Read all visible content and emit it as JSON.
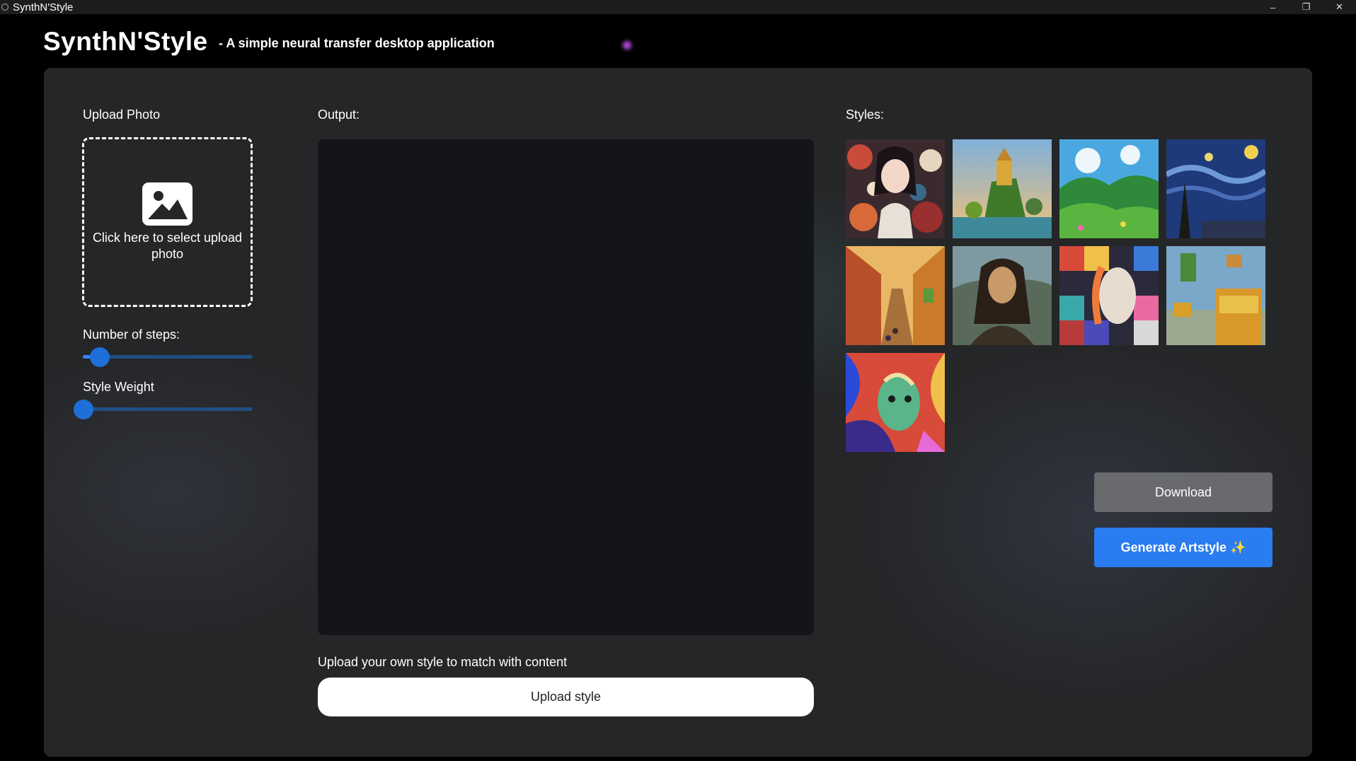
{
  "window": {
    "title": "SynthN'Style",
    "minimize": "–",
    "restore": "❐",
    "close": "✕"
  },
  "header": {
    "brand": "SynthN'Style",
    "tagline": "- A simple neural transfer desktop application"
  },
  "left": {
    "upload_label": "Upload Photo",
    "upload_prompt": "Click here to select upload photo",
    "steps_label": "Number of steps:",
    "steps_value": 0.1,
    "weight_label": "Style Weight",
    "weight_value": 0.0
  },
  "center": {
    "output_label": "Output:",
    "upload_own_label": "Upload your own style to match with content",
    "upload_style_button": "Upload style"
  },
  "right": {
    "styles_label": "Styles:",
    "styles": [
      {
        "icon": "anime-girl-floral-style"
      },
      {
        "icon": "fantasy-castle-landscape-style"
      },
      {
        "icon": "green-hills-landscape-style"
      },
      {
        "icon": "starry-night-style"
      },
      {
        "icon": "street-painting-style"
      },
      {
        "icon": "mona-lisa-style"
      },
      {
        "icon": "cubist-portrait-style"
      },
      {
        "icon": "van-gogh-bedroom-style"
      },
      {
        "icon": "abstract-face-style"
      }
    ],
    "download_button": "Download",
    "generate_button": "Generate Artstyle ✨"
  },
  "colors": {
    "accent": "#2a7cf1",
    "panel": "#252628",
    "output": "#141518",
    "slider": "#1f6fd8"
  }
}
